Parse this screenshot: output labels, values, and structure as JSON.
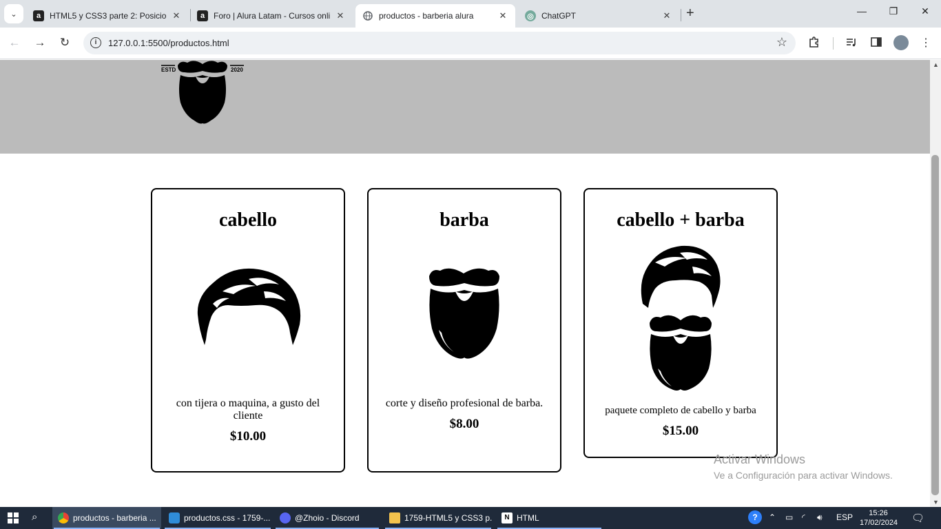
{
  "browser": {
    "tabs": [
      {
        "title": "HTML5 y CSS3 parte 2: Posicion",
        "favicon": "alura-icon",
        "active": false
      },
      {
        "title": "Foro | Alura Latam - Cursos onli",
        "favicon": "alura-icon",
        "active": false
      },
      {
        "title": "productos - barberia alura",
        "favicon": "globe-icon",
        "active": true
      },
      {
        "title": "ChatGPT",
        "favicon": "chatgpt-icon",
        "active": false
      }
    ],
    "url": "127.0.0.1:5500/productos.html"
  },
  "page": {
    "logo": {
      "left_text": "ESTD",
      "right_text": "2020"
    },
    "products": [
      {
        "title": "cabello",
        "image": "hair-icon",
        "description": "con tijera o maquina, a gusto del cliente",
        "price": "$10.00"
      },
      {
        "title": "barba",
        "image": "beard-icon",
        "description": "corte y diseño profesional de barba.",
        "price": "$8.00"
      },
      {
        "title": "cabello + barba",
        "image": "hair-and-beard-icon",
        "description": "paquete completo de cabello y barba",
        "price": "$15.00"
      }
    ],
    "watermark": {
      "line1": "Activar Windows",
      "line2": "Ve a Configuración para activar Windows."
    }
  },
  "taskbar": {
    "items": [
      {
        "label": "productos - barberia ...",
        "icon": "chrome-icon",
        "active": true
      },
      {
        "label": "productos.css - 1759-...",
        "icon": "vscode-icon",
        "active": false
      },
      {
        "label": "@Zhoio - Discord",
        "icon": "discord-icon",
        "active": false
      },
      {
        "label": "1759-HTML5 y CSS3 p...",
        "icon": "folder-icon",
        "active": false
      },
      {
        "label": "HTML",
        "icon": "notion-icon",
        "active": false
      }
    ],
    "language": "ESP",
    "time": "15:26",
    "date": "17/02/2024"
  },
  "colors": {
    "header_bg": "#bbbbbb",
    "tabstrip_bg": "#dfe3e7",
    "taskbar_bg": "#1f2a3a"
  }
}
